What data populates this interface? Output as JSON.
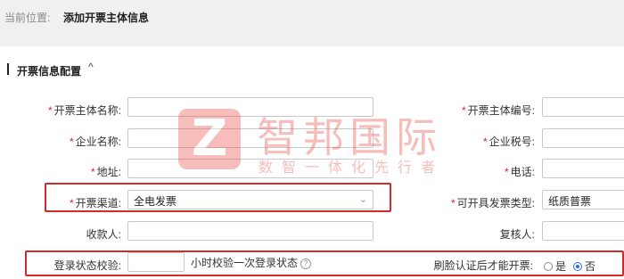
{
  "breadcrumb": {
    "label": "当前位置:",
    "current": "添加开票主体信息"
  },
  "section": {
    "title": "开票信息配置",
    "toggle": "^"
  },
  "fields": {
    "entity_name": {
      "label": "开票主体名称:",
      "value": ""
    },
    "entity_code": {
      "label": "开票主体编号:",
      "value": ""
    },
    "company_name": {
      "label": "企业名称:",
      "value": ""
    },
    "tax_number": {
      "label": "企业税号:",
      "value": ""
    },
    "address": {
      "label": "地址:",
      "value": ""
    },
    "phone": {
      "label": "电话:",
      "value": ""
    },
    "channel": {
      "label": "开票渠道:",
      "value": "全电发票"
    },
    "invoice_type": {
      "label": "可开具发票类型:",
      "value": "纸质普票"
    },
    "payee": {
      "label": "收款人:",
      "value": ""
    },
    "reviewer": {
      "label": "复核人:",
      "value": ""
    },
    "login_check": {
      "label": "登录状态校验:",
      "value": "",
      "hint": "小时校验一次登录状态"
    },
    "face_auth": {
      "label": "刷脸认证后才能开票:",
      "options": [
        "是",
        "否"
      ],
      "selected": "否"
    }
  },
  "required_mark": "*",
  "watermark": {
    "logo_letter": "Z",
    "title": "智邦国际",
    "subtitle": "数智一体化先行者"
  },
  "colors": {
    "required": "#e02020",
    "highlight": "#d22b2b",
    "radio_selected": "#2f6bd8",
    "watermark": "#e8554e"
  }
}
